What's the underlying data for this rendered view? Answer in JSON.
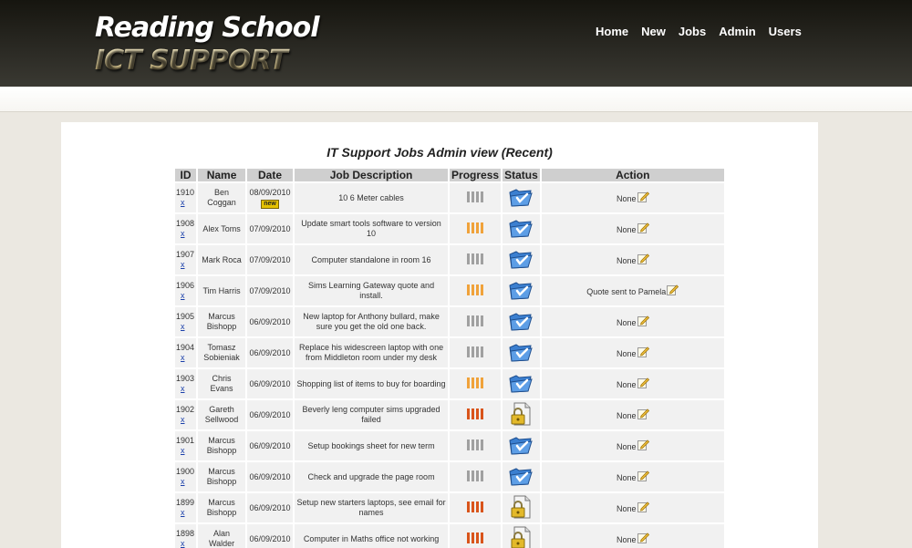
{
  "logo": {
    "line1": "Reading School",
    "line2": "ICT SUPPORT"
  },
  "nav": [
    "Home",
    "New",
    "Jobs",
    "Admin",
    "Users"
  ],
  "page": {
    "title": "IT Support Jobs Admin view (Recent)"
  },
  "table": {
    "headers": [
      "ID",
      "Name",
      "Date",
      "Job Description",
      "Progress",
      "Status",
      "Action"
    ],
    "delete_label": "x",
    "new_badge": "new",
    "rows": [
      {
        "id": "1910",
        "name": "Ben Coggan",
        "date": "08/09/2010",
        "is_new": true,
        "description": "10 6 Meter cables",
        "progress": "grey",
        "status": "checked-folder",
        "action": "None"
      },
      {
        "id": "1908",
        "name": "Alex Toms",
        "date": "07/09/2010",
        "is_new": false,
        "description": "Update smart tools software to version 10",
        "progress": "orange",
        "status": "checked-folder",
        "action": "None"
      },
      {
        "id": "1907",
        "name": "Mark Roca",
        "date": "07/09/2010",
        "is_new": false,
        "description": "Computer standalone in room 16",
        "progress": "grey",
        "status": "checked-folder",
        "action": "None"
      },
      {
        "id": "1906",
        "name": "Tim Harris",
        "date": "07/09/2010",
        "is_new": false,
        "description": "Sims Learning Gateway quote and install.",
        "progress": "orange",
        "status": "checked-folder",
        "action": "Quote sent to Pamela"
      },
      {
        "id": "1905",
        "name": "Marcus Bishopp",
        "date": "06/09/2010",
        "is_new": false,
        "description": "New laptop for Anthony bullard, make sure you get the old one back.",
        "progress": "grey",
        "status": "checked-folder",
        "action": "None"
      },
      {
        "id": "1904",
        "name": "Tomasz Sobieniak",
        "date": "06/09/2010",
        "is_new": false,
        "description": "Replace his widescreen laptop with one from Middleton room under my desk",
        "progress": "grey",
        "status": "checked-folder",
        "action": "None"
      },
      {
        "id": "1903",
        "name": "Chris Evans",
        "date": "06/09/2010",
        "is_new": false,
        "description": "Shopping list of items to buy for boarding",
        "progress": "orange",
        "status": "checked-folder",
        "action": "None"
      },
      {
        "id": "1902",
        "name": "Gareth Sellwood",
        "date": "06/09/2010",
        "is_new": false,
        "description": "Beverly leng computer sims upgraded failed",
        "progress": "red",
        "status": "locked-document",
        "action": "None"
      },
      {
        "id": "1901",
        "name": "Marcus Bishopp",
        "date": "06/09/2010",
        "is_new": false,
        "description": "Setup bookings sheet for new term",
        "progress": "grey",
        "status": "checked-folder",
        "action": "None"
      },
      {
        "id": "1900",
        "name": "Marcus Bishopp",
        "date": "06/09/2010",
        "is_new": false,
        "description": "Check and upgrade the page room",
        "progress": "grey",
        "status": "checked-folder",
        "action": "None"
      },
      {
        "id": "1899",
        "name": "Marcus Bishopp",
        "date": "06/09/2010",
        "is_new": false,
        "description": "Setup new starters laptops, see email for names",
        "progress": "red",
        "status": "locked-document",
        "action": "None"
      },
      {
        "id": "1898",
        "name": "Alan Walder",
        "date": "06/09/2010",
        "is_new": false,
        "description": "Computer in Maths office not working",
        "progress": "red",
        "status": "locked-document",
        "action": "None"
      }
    ]
  },
  "colors": {
    "header_dark": "#16150f",
    "page_bg": "#ebe8e1",
    "table_header": "#cfcfcf",
    "row_bg": "#f1f1f1",
    "link": "#1a3faa",
    "progress_grey": "#a0a0a0",
    "progress_orange": "#f0a23a",
    "progress_red": "#d9541a"
  }
}
